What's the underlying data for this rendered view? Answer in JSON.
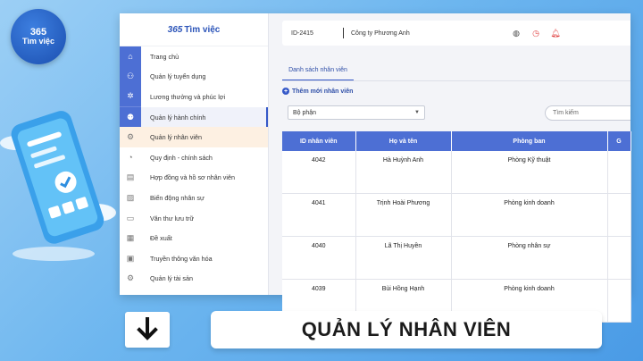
{
  "logo": {
    "number": "365",
    "text": "Tìm việc"
  },
  "brand": {
    "number": "365",
    "text": "Tìm việc"
  },
  "header": {
    "id": "ID-2415",
    "company": "Công ty Phương Anh"
  },
  "sidebar": {
    "items": [
      {
        "label": "Trang chủ",
        "icon": "home-icon"
      },
      {
        "label": "Quản lý tuyển dụng",
        "icon": "users-icon"
      },
      {
        "label": "Lương thưởng và phúc lợi",
        "icon": "settings-icon"
      },
      {
        "label": "Quản lý hành chính",
        "icon": "group-icon"
      },
      {
        "label": "Quản lý nhân viên",
        "icon": "employee-icon"
      },
      {
        "label": "Quy định - chính sách",
        "icon": "policy-icon"
      },
      {
        "label": "Hợp đồng và hồ sơ nhân viên",
        "icon": "contract-icon"
      },
      {
        "label": "Biến động nhân sự",
        "icon": "change-icon"
      },
      {
        "label": "Văn thư lưu trữ",
        "icon": "archive-icon"
      },
      {
        "label": "Đề xuất",
        "icon": "proposal-icon"
      },
      {
        "label": "Truyền thông văn hóa",
        "icon": "media-icon"
      },
      {
        "label": "Quản lý tài sản",
        "icon": "asset-icon"
      }
    ]
  },
  "main": {
    "tab": "Danh sách nhân viên",
    "add_label": "Thêm mới nhân viên",
    "select_value": "Bộ phận",
    "search_placeholder": "Tìm kiếm",
    "columns": [
      "ID nhân viên",
      "Họ và tên",
      "Phòng ban",
      "G"
    ],
    "rows": [
      {
        "id": "4042",
        "name": "Hà Huỳnh Anh",
        "dept": "Phòng Kỹ thuật"
      },
      {
        "id": "4041",
        "name": "Trịnh Hoài Phương",
        "dept": "Phòng kinh doanh"
      },
      {
        "id": "4040",
        "name": "Lã Thị Huyền",
        "dept": "Phòng nhân sự"
      },
      {
        "id": "4039",
        "name": "Bùi Hồng Hạnh",
        "dept": "Phòng kinh doanh"
      }
    ]
  },
  "banner": {
    "title": "QUẢN LÝ NHÂN VIÊN"
  },
  "colors": {
    "primary": "#4d6fd4",
    "accent": "#3558c8",
    "background": "#6db6ef"
  }
}
